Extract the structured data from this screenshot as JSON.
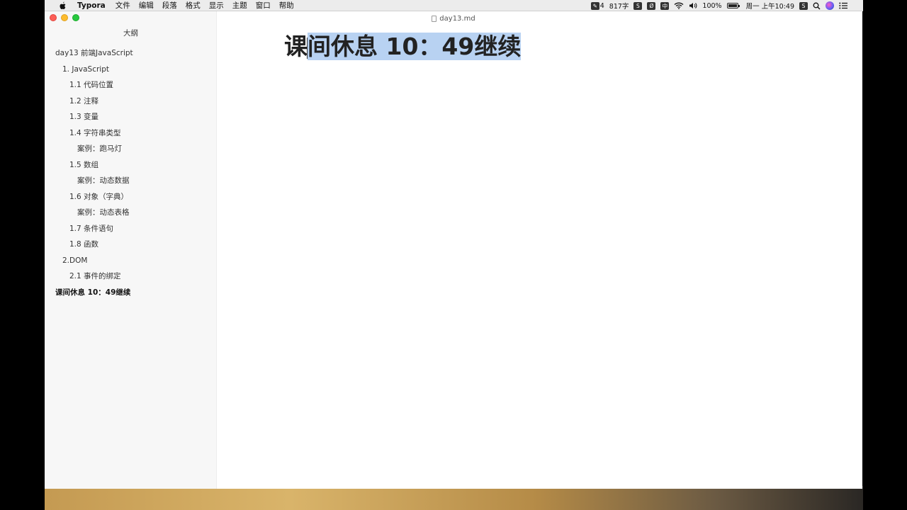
{
  "menubar": {
    "app_name": "Typora",
    "menus": [
      "文件",
      "编辑",
      "段落",
      "格式",
      "显示",
      "主题",
      "窗口",
      "帮助"
    ],
    "status": {
      "notification_count": "4",
      "word_count": "817字",
      "ime_label": "中",
      "battery_percent": "100%",
      "battery_level": 1.0,
      "clock": "周一 上午10:49"
    }
  },
  "window": {
    "document_title": "day13.md"
  },
  "sidebar": {
    "title": "大纲",
    "items": [
      {
        "label": "day13 前端JavaScript",
        "level": 1
      },
      {
        "label": "1. JavaScript",
        "level": 2
      },
      {
        "label": "1.1 代码位置",
        "level": 3
      },
      {
        "label": "1.2 注释",
        "level": 3
      },
      {
        "label": "1.3 变量",
        "level": 3
      },
      {
        "label": "1.4 字符串类型",
        "level": 3
      },
      {
        "label": "案例：跑马灯",
        "level": 4
      },
      {
        "label": "1.5 数组",
        "level": 3
      },
      {
        "label": "案例：动态数据",
        "level": 4
      },
      {
        "label": "1.6 对象（字典）",
        "level": 3
      },
      {
        "label": "案例：动态表格",
        "level": 4
      },
      {
        "label": "1.7 条件语句",
        "level": 3
      },
      {
        "label": "1.8 函数",
        "level": 3
      },
      {
        "label": "2.DOM",
        "level": 2
      },
      {
        "label": "2.1 事件的绑定",
        "level": 3
      },
      {
        "label": "课间休息 10：49继续",
        "level": 1,
        "active": true
      }
    ]
  },
  "editor": {
    "heading_unselected": "课",
    "heading_selected": "间休息 10：49继续"
  },
  "colors": {
    "selection": "#b8d2f2",
    "sidebar_bg": "#f7f7f7"
  }
}
